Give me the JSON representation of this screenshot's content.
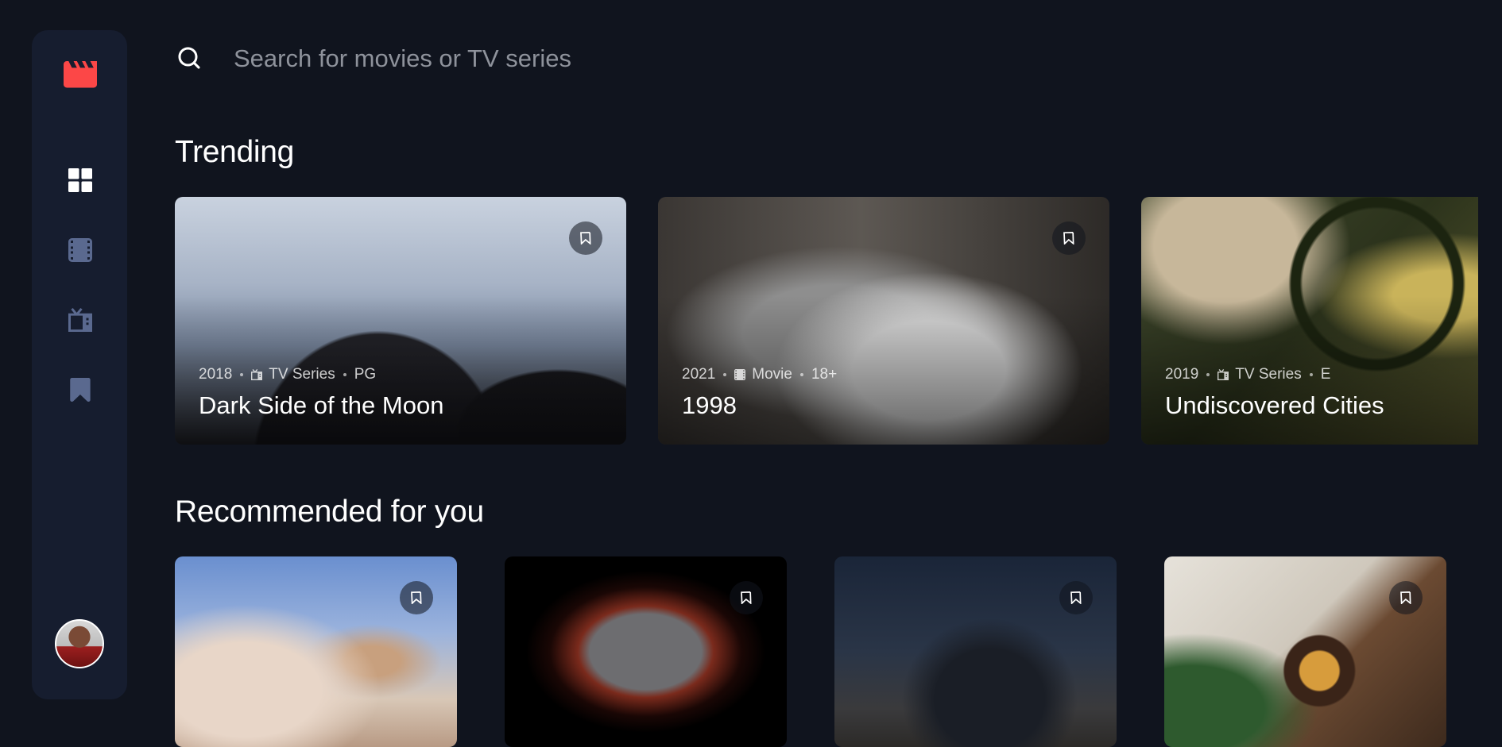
{
  "colors": {
    "background": "#10141E",
    "sidebar": "#161D2F",
    "accent": "#FC4747",
    "nav_active": "#FFFFFF",
    "nav_inactive": "#5A698F"
  },
  "sidebar": {
    "logo_icon": "clapperboard-icon",
    "nav_items": [
      {
        "icon": "grid-icon",
        "active": true
      },
      {
        "icon": "film-icon",
        "active": false
      },
      {
        "icon": "tv-icon",
        "active": false
      },
      {
        "icon": "bookmark-icon",
        "active": false
      }
    ],
    "avatar_icon": "user-avatar"
  },
  "search": {
    "placeholder": "Search for movies or TV series"
  },
  "sections": {
    "trending_title": "Trending",
    "recommended_title": "Recommended for you"
  },
  "trending": [
    {
      "year": "2018",
      "category": "TV Series",
      "category_icon": "tv-icon",
      "rating": "PG",
      "title": "Dark Side of the Moon"
    },
    {
      "year": "2021",
      "category": "Movie",
      "category_icon": "film-icon",
      "rating": "18+",
      "title": "1998"
    },
    {
      "year": "2019",
      "category": "TV Series",
      "category_icon": "tv-icon",
      "rating": "E",
      "title": "Undiscovered Cities"
    }
  ],
  "recommended": [
    {
      "image_icon": "rocket-launch-image"
    },
    {
      "image_icon": "city-through-window-image"
    },
    {
      "image_icon": "dragon-creature-image"
    },
    {
      "image_icon": "food-bowl-image"
    }
  ]
}
